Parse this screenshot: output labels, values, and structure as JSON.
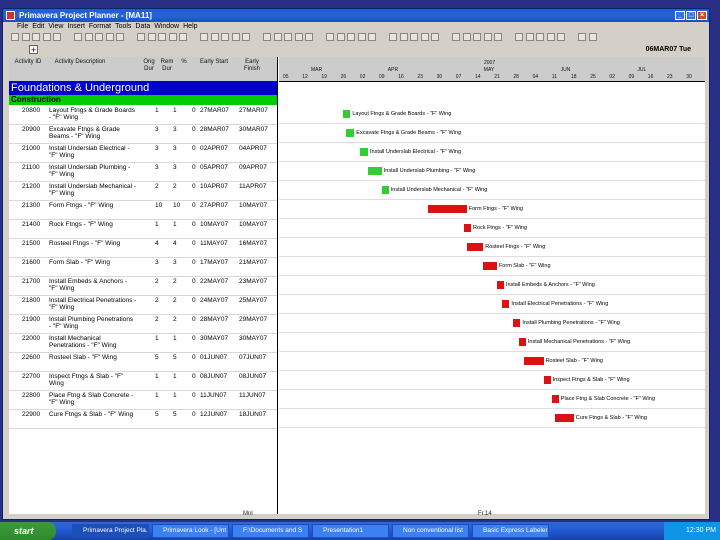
{
  "window": {
    "title": "Primavera Project Planner - [MA11]"
  },
  "menu": [
    "File",
    "Edit",
    "View",
    "Insert",
    "Format",
    "Tools",
    "Data",
    "Window",
    "Help"
  ],
  "toolbar": {
    "date": "06MAR07 Tue"
  },
  "columns": {
    "activity_id": "Activity ID",
    "activity_desc": "Activity Description",
    "orig_dur": "Orig Dur",
    "rem_dur": "Rem Dur",
    "pct": "%",
    "early_start": "Early Start",
    "early_finish": "Early Finish"
  },
  "timescale": {
    "year": "2007",
    "months": [
      "MAR",
      "APR",
      "MAY",
      "JUN",
      "JUL"
    ],
    "days": [
      "05",
      "12",
      "19",
      "26",
      "02",
      "09",
      "16",
      "23",
      "30",
      "07",
      "14",
      "21",
      "28",
      "04",
      "11",
      "18",
      "25",
      "02",
      "09",
      "16",
      "23",
      "30"
    ]
  },
  "section": {
    "title": "Foundations & Underground",
    "subtitle": "Construction"
  },
  "activities": [
    {
      "id": "20800",
      "desc": "Layout Ftngs & Grade Boards - \"F\" Wing",
      "od": "1",
      "rd": "1",
      "pct": "0",
      "es": "27MAR07",
      "ef": "27MAR07",
      "bar": "Layout Ftngs & Grade Boards - \"F\" Wing",
      "color": "#33cc33"
    },
    {
      "id": "20900",
      "desc": "Excavate Ftngs & Grade Beams - \"F\" Wing",
      "od": "3",
      "rd": "3",
      "pct": "0",
      "es": "28MAR07",
      "ef": "30MAR07",
      "bar": "Excavate Ftngs & Grade Beams - \"F\" Wing",
      "color": "#33cc33"
    },
    {
      "id": "21000",
      "desc": "Install Underslab Electrical - \"F\" Wing",
      "od": "3",
      "rd": "3",
      "pct": "0",
      "es": "02APR07",
      "ef": "04APR07",
      "bar": "Install Underslab Electrical - \"F\" Wing",
      "color": "#33cc33"
    },
    {
      "id": "21100",
      "desc": "Install Underslab Plumbing - \"F\" Wing",
      "od": "3",
      "rd": "3",
      "pct": "0",
      "es": "05APR07",
      "ef": "09APR07",
      "bar": "Install Underslab Plumbing - \"F\" Wing",
      "color": "#33cc33"
    },
    {
      "id": "21200",
      "desc": "Install Underslab Mechanical - \"F\" Wing",
      "od": "2",
      "rd": "2",
      "pct": "0",
      "es": "10APR07",
      "ef": "11APR07",
      "bar": "Install Underslab Mechanical - \"F\" Wing",
      "color": "#33cc33"
    },
    {
      "id": "21300",
      "desc": "Form Ftngs - \"F\" Wing",
      "od": "10",
      "rd": "10",
      "pct": "0",
      "es": "27APR07",
      "ef": "10MAY07",
      "bar": "Form Ftngs - \"F\" Wing",
      "color": "#dd1111"
    },
    {
      "id": "21400",
      "desc": "Rock Ftngs - \"F\" Wing",
      "od": "1",
      "rd": "1",
      "pct": "0",
      "es": "10MAY07",
      "ef": "10MAY07",
      "bar": "Rock Ftngs - \"F\" Wing",
      "color": "#dd1111"
    },
    {
      "id": "21500",
      "desc": "Rosteel Ftngs - \"F\" Wing",
      "od": "4",
      "rd": "4",
      "pct": "0",
      "es": "11MAY07",
      "ef": "16MAY07",
      "bar": "Rosteel Ftngs - \"F\" Wing",
      "color": "#dd1111"
    },
    {
      "id": "21600",
      "desc": "Form Slab - \"F\" Wing",
      "od": "3",
      "rd": "3",
      "pct": "0",
      "es": "17MAY07",
      "ef": "21MAY07",
      "bar": "Form Slab - \"F\" Wing",
      "color": "#dd1111"
    },
    {
      "id": "21700",
      "desc": "Install Embeds & Anchors - \"F\" Wing",
      "od": "2",
      "rd": "2",
      "pct": "0",
      "es": "22MAY07",
      "ef": "23MAY07",
      "bar": "Install Embeds & Anchors - \"F\" Wing",
      "color": "#dd1111"
    },
    {
      "id": "21800",
      "desc": "Install Electrical Penetrations - \"F\" Wing",
      "od": "2",
      "rd": "2",
      "pct": "0",
      "es": "24MAY07",
      "ef": "25MAY07",
      "bar": "Install Electrical Penetrations - \"F\" Wing",
      "color": "#dd1111"
    },
    {
      "id": "21900",
      "desc": "Install Plumbing Penetrations - \"F\" Wing",
      "od": "2",
      "rd": "2",
      "pct": "0",
      "es": "28MAY07",
      "ef": "29MAY07",
      "bar": "Install Plumbing Penetrations - \"F\" Wing",
      "color": "#dd1111"
    },
    {
      "id": "22000",
      "desc": "Install Mechanical Penetrations - \"F\" Wing",
      "od": "1",
      "rd": "1",
      "pct": "0",
      "es": "30MAY07",
      "ef": "30MAY07",
      "bar": "Install Mechanical Penetrations - \"F\" Wing",
      "color": "#dd1111"
    },
    {
      "id": "22600",
      "desc": "Rosteel Slab - \"F\" Wing",
      "od": "5",
      "rd": "5",
      "pct": "0",
      "es": "01JUN07",
      "ef": "07JUN07",
      "bar": "Rosteel Slab - \"F\" Wing",
      "color": "#dd1111"
    },
    {
      "id": "22700",
      "desc": "Inspect Ftngs & Slab - \"F\" Wing",
      "od": "1",
      "rd": "1",
      "pct": "0",
      "es": "08JUN07",
      "ef": "08JUN07",
      "bar": "Inspect Ftngs & Slab - \"F\" Wing",
      "color": "#dd1111"
    },
    {
      "id": "22800",
      "desc": "Place Ftng & Slab Concrete - \"F\" Wing",
      "od": "1",
      "rd": "1",
      "pct": "0",
      "es": "11JUN07",
      "ef": "11JUN07",
      "bar": "Place Ftng & Slab Concrete - \"F\" Wing",
      "color": "#dd1111"
    },
    {
      "id": "22900",
      "desc": "Cure Ftngs & Slab - \"F\" Wing",
      "od": "5",
      "rd": "5",
      "pct": "0",
      "es": "12JUN07",
      "ef": "18JUN07",
      "bar": "Cure Ftngs & Slab - \"F\" Wing",
      "color": "#dd1111"
    }
  ],
  "status": {
    "left": "Mnl",
    "right": "Fr.14"
  },
  "taskbar": {
    "start": "start",
    "tasks": [
      "Primavera Project Pla...",
      "Primavera Look - [Unt",
      "F:\\Documents and S",
      "Presentation1",
      "Non conventional list",
      "Basic Express Labeler"
    ],
    "clock": "12:30 PM"
  }
}
